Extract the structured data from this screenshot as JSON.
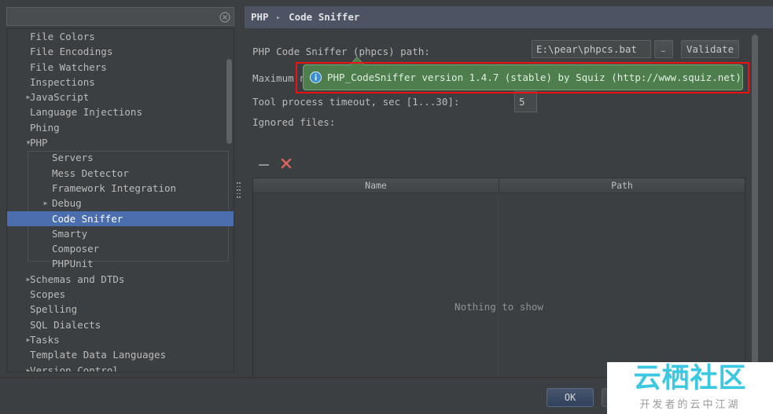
{
  "colors": {
    "accent_selection": "#4b6eaf",
    "header_bg": "#4c5363",
    "balloon_bg": "#4e7e4e",
    "highlight_border": "#ee1111",
    "watermark_brand": "#3cc8e0",
    "danger": "#d9534f"
  },
  "search": {
    "value": "",
    "placeholder": "",
    "clear_icon": "clear-circle-icon"
  },
  "sidebar": {
    "items": [
      {
        "label": "File Colors",
        "indent": 0,
        "expandable": false,
        "expanded": false,
        "selected": false
      },
      {
        "label": "File Encodings",
        "indent": 0,
        "expandable": false,
        "expanded": false,
        "selected": false
      },
      {
        "label": "File Watchers",
        "indent": 0,
        "expandable": false,
        "expanded": false,
        "selected": false
      },
      {
        "label": "Inspections",
        "indent": 0,
        "expandable": false,
        "expanded": false,
        "selected": false
      },
      {
        "label": "JavaScript",
        "indent": 0,
        "expandable": true,
        "expanded": false,
        "selected": false
      },
      {
        "label": "Language Injections",
        "indent": 0,
        "expandable": false,
        "expanded": false,
        "selected": false
      },
      {
        "label": "Phing",
        "indent": 0,
        "expandable": false,
        "expanded": false,
        "selected": false
      },
      {
        "label": "PHP",
        "indent": 0,
        "expandable": true,
        "expanded": true,
        "selected": false
      },
      {
        "label": "Servers",
        "indent": 1,
        "expandable": false,
        "expanded": false,
        "selected": false
      },
      {
        "label": "Mess Detector",
        "indent": 1,
        "expandable": false,
        "expanded": false,
        "selected": false
      },
      {
        "label": "Framework Integration",
        "indent": 1,
        "expandable": false,
        "expanded": false,
        "selected": false
      },
      {
        "label": "Debug",
        "indent": 1,
        "expandable": true,
        "expanded": false,
        "selected": false
      },
      {
        "label": "Code Sniffer",
        "indent": 1,
        "expandable": false,
        "expanded": false,
        "selected": true
      },
      {
        "label": "Smarty",
        "indent": 1,
        "expandable": false,
        "expanded": false,
        "selected": false
      },
      {
        "label": "Composer",
        "indent": 1,
        "expandable": false,
        "expanded": false,
        "selected": false
      },
      {
        "label": "PHPUnit",
        "indent": 1,
        "expandable": false,
        "expanded": false,
        "selected": false
      },
      {
        "label": "Schemas and DTDs",
        "indent": 0,
        "expandable": true,
        "expanded": false,
        "selected": false
      },
      {
        "label": "Scopes",
        "indent": 0,
        "expandable": false,
        "expanded": false,
        "selected": false
      },
      {
        "label": "Spelling",
        "indent": 0,
        "expandable": false,
        "expanded": false,
        "selected": false
      },
      {
        "label": "SQL Dialects",
        "indent": 0,
        "expandable": false,
        "expanded": false,
        "selected": false
      },
      {
        "label": "Tasks",
        "indent": 0,
        "expandable": true,
        "expanded": false,
        "selected": false
      },
      {
        "label": "Template Data Languages",
        "indent": 0,
        "expandable": false,
        "expanded": false,
        "selected": false
      },
      {
        "label": "Version Control",
        "indent": 0,
        "expandable": true,
        "expanded": false,
        "selected": false
      }
    ]
  },
  "panel": {
    "breadcrumb_root": "PHP",
    "breadcrumb_leaf": "Code Sniffer",
    "breadcrumb_separator": "▸"
  },
  "form": {
    "path_label": "PHP Code Sniffer (phpcs) path:",
    "path_value": "E:\\pear\\phpcs.bat",
    "browse_label": "…",
    "validate_label": "Validate",
    "max_label": "Maximum n…",
    "max_value": "",
    "timeout_label": "Tool process timeout, sec [1...30]:",
    "timeout_value": "5",
    "ignored_label": "Ignored files:",
    "remove_icon": "minus-icon",
    "delete_icon": "red-x-icon"
  },
  "table": {
    "columns": [
      "Name",
      "Path"
    ],
    "rows": [],
    "empty_text": "Nothing to show"
  },
  "balloon": {
    "icon": "info-icon",
    "text": "PHP_CodeSniffer version 1.4.7 (stable) by Squiz (http://www.squiz.net)"
  },
  "footer": {
    "ok_label": "OK",
    "cancel_label": ""
  },
  "watermark": {
    "main": "云栖社区",
    "sub": "开发者的云中江湖"
  }
}
